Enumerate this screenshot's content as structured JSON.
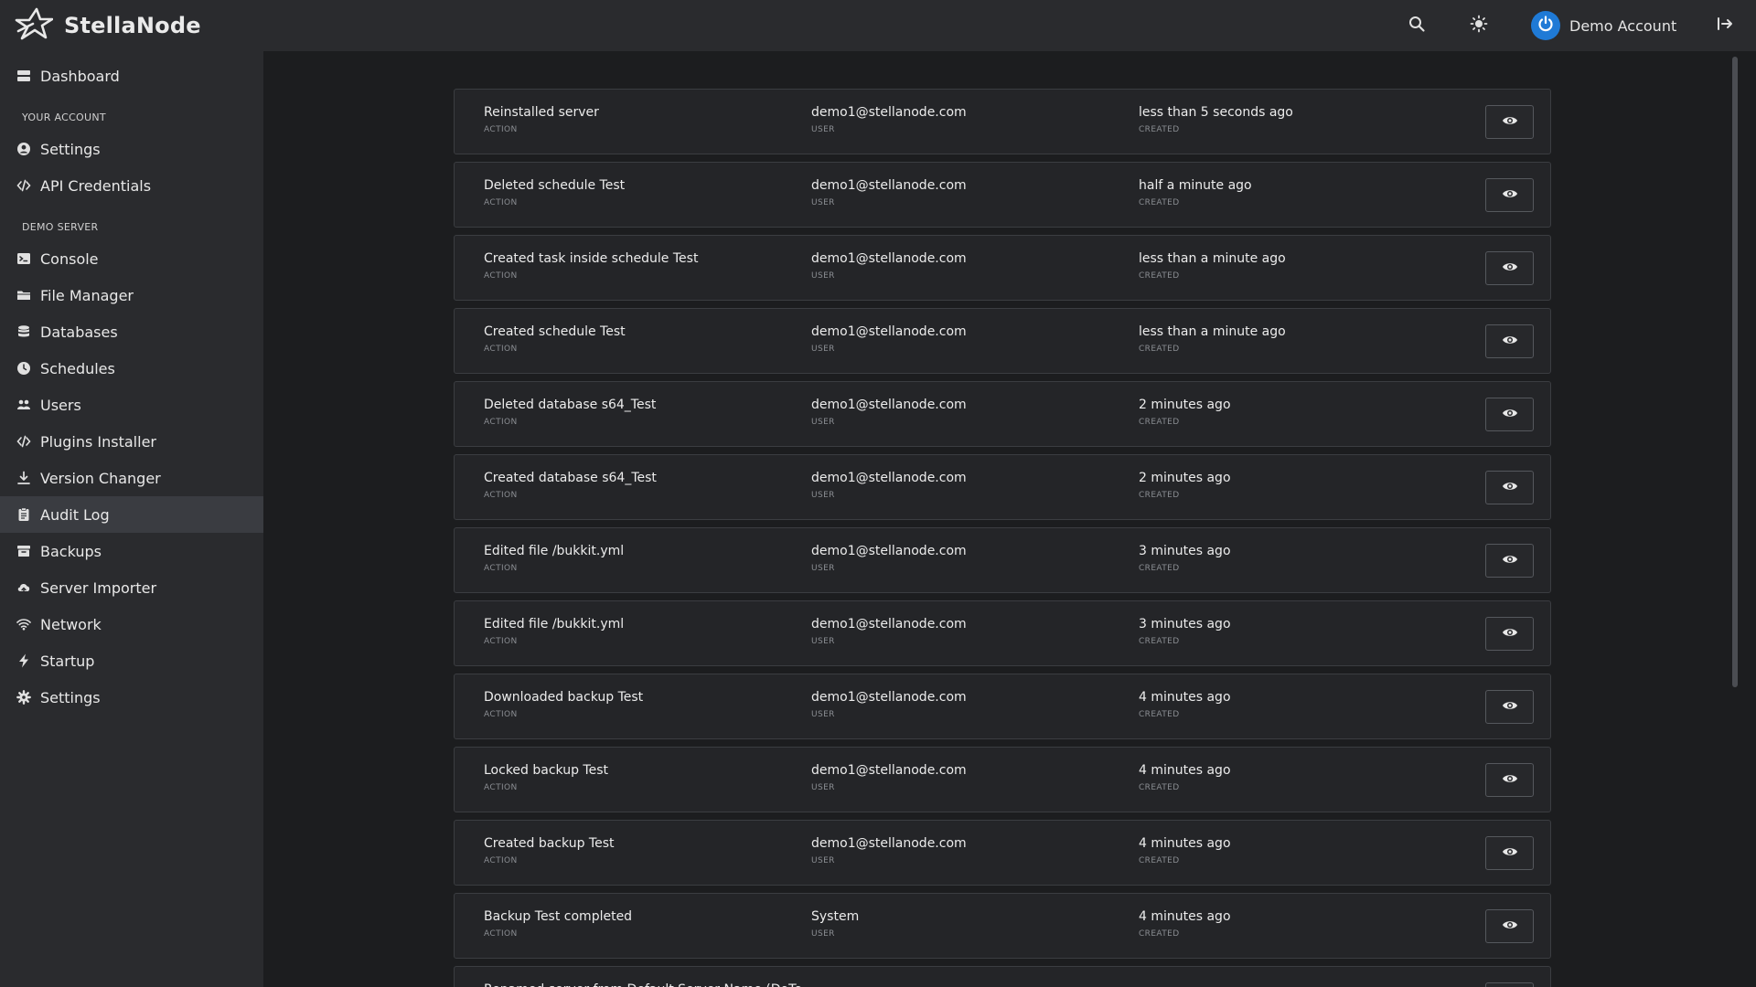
{
  "brand": {
    "name": "StellaNode"
  },
  "header": {
    "search_icon": "search-icon",
    "theme_icon": "sun-icon",
    "account_name": "Demo Account",
    "logout_icon": "logout-icon"
  },
  "sidebar": {
    "dashboard": "Dashboard",
    "your_account_label": "YOUR ACCOUNT",
    "account_items": [
      {
        "label": "Settings",
        "icon": "user-circle-icon"
      },
      {
        "label": "API Credentials",
        "icon": "code-icon"
      }
    ],
    "server_label": "DEMO SERVER",
    "server_items": [
      {
        "label": "Console",
        "icon": "terminal-icon"
      },
      {
        "label": "File Manager",
        "icon": "folder-icon"
      },
      {
        "label": "Databases",
        "icon": "database-icon"
      },
      {
        "label": "Schedules",
        "icon": "clock-icon"
      },
      {
        "label": "Users",
        "icon": "users-icon"
      },
      {
        "label": "Plugins Installer",
        "icon": "code-icon"
      },
      {
        "label": "Version Changer",
        "icon": "download-icon"
      },
      {
        "label": "Audit Log",
        "icon": "clipboard-icon",
        "active": true
      },
      {
        "label": "Backups",
        "icon": "archive-icon"
      },
      {
        "label": "Server Importer",
        "icon": "cloud-upload-icon"
      },
      {
        "label": "Network",
        "icon": "wifi-icon"
      },
      {
        "label": "Startup",
        "icon": "bolt-icon"
      },
      {
        "label": "Settings",
        "icon": "gear-icon"
      }
    ]
  },
  "audit": {
    "labels": {
      "action": "ACTION",
      "user": "USER",
      "created": "CREATED"
    },
    "rows": [
      {
        "action": "Reinstalled server",
        "user": "demo1@stellanode.com",
        "created": "less than 5 seconds ago"
      },
      {
        "action": "Deleted schedule Test",
        "user": "demo1@stellanode.com",
        "created": "half a minute ago"
      },
      {
        "action": "Created task inside schedule Test",
        "user": "demo1@stellanode.com",
        "created": "less than a minute ago"
      },
      {
        "action": "Created schedule Test",
        "user": "demo1@stellanode.com",
        "created": "less than a minute ago"
      },
      {
        "action": "Deleted database s64_Test",
        "user": "demo1@stellanode.com",
        "created": "2 minutes ago"
      },
      {
        "action": "Created database s64_Test",
        "user": "demo1@stellanode.com",
        "created": "2 minutes ago"
      },
      {
        "action": "Edited file /bukkit.yml",
        "user": "demo1@stellanode.com",
        "created": "3 minutes ago"
      },
      {
        "action": "Edited file /bukkit.yml",
        "user": "demo1@stellanode.com",
        "created": "3 minutes ago"
      },
      {
        "action": "Downloaded backup Test",
        "user": "demo1@stellanode.com",
        "created": "4 minutes ago"
      },
      {
        "action": "Locked backup Test",
        "user": "demo1@stellanode.com",
        "created": "4 minutes ago"
      },
      {
        "action": "Created backup Test",
        "user": "demo1@stellanode.com",
        "created": "4 minutes ago"
      },
      {
        "action": "Backup Test completed",
        "user": "System",
        "created": "4 minutes ago"
      },
      {
        "action": "Renamed server from Default Server Name (DoTe",
        "user": "",
        "created": ""
      }
    ]
  }
}
